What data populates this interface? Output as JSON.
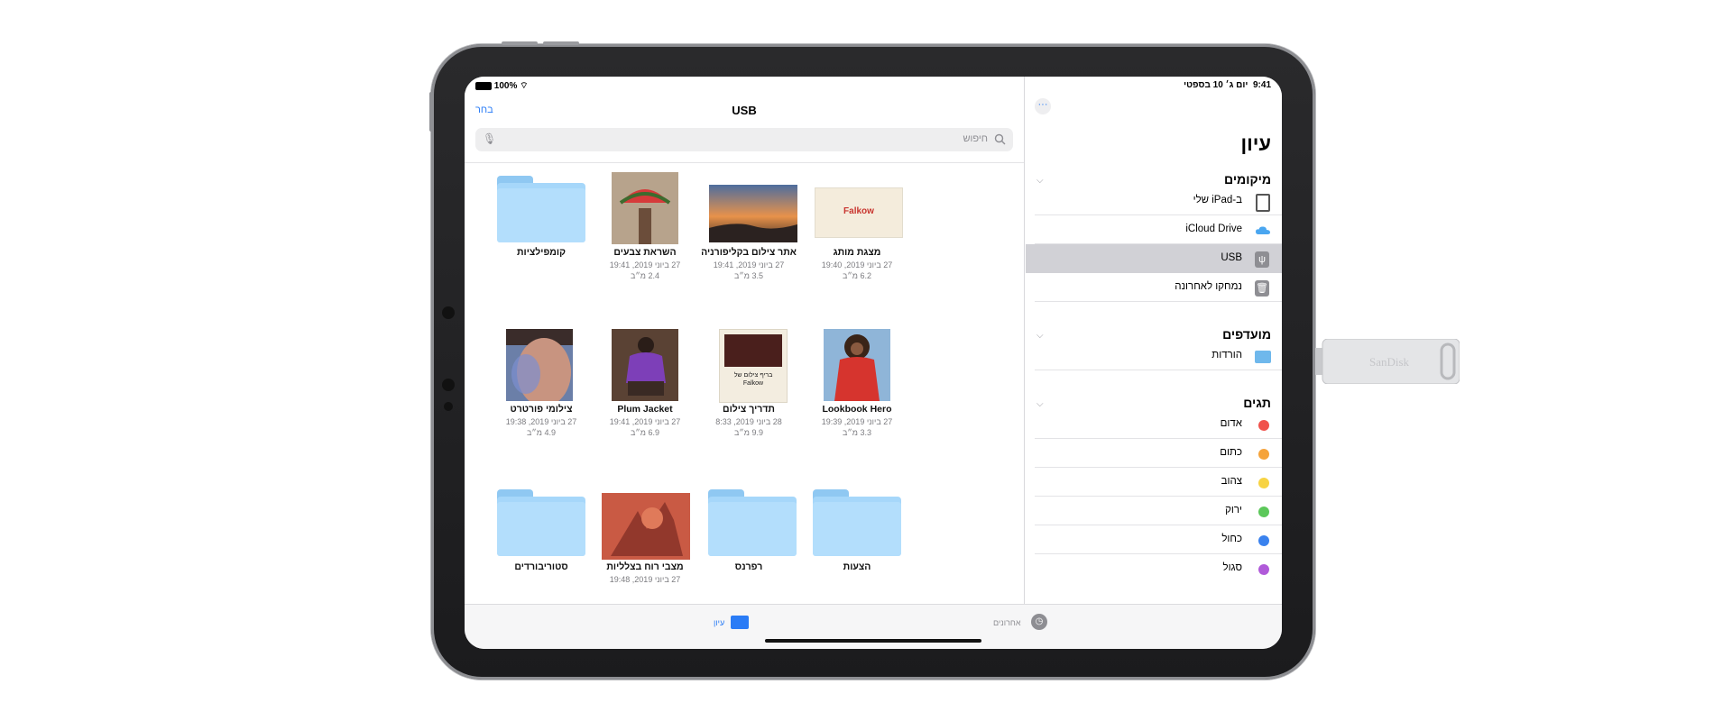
{
  "status": {
    "battery": "100%",
    "time": "9:41",
    "date": "יום ג׳ 10 בספטי"
  },
  "header": {
    "title": "USB",
    "select_label": "בחר",
    "search_placeholder": "חיפוש"
  },
  "grid": [
    {
      "kind": "folder",
      "name": "קומפילציות",
      "date": "",
      "size": ""
    },
    {
      "kind": "photo-watermelon",
      "name": "השראת צבעים",
      "date": "27 ביוני 2019, 19:41",
      "size": "2.4 מ״ב"
    },
    {
      "kind": "photo-sunset",
      "name": "אתר צילום בקליפורניה",
      "date": "27 ביוני 2019, 19:41",
      "size": "3.5 מ״ב"
    },
    {
      "kind": "doc-falkow",
      "name": "מצגת מותג",
      "date": "27 ביוני 2019, 19:40",
      "size": "6.2 מ״ב",
      "thumb_text": "Falkow"
    },
    {
      "kind": "photo-face",
      "name": "צילומי פורטרט",
      "date": "27 ביוני 2019, 19:38",
      "size": "4.9 מ״ב"
    },
    {
      "kind": "photo-purple",
      "name": "Plum Jacket",
      "date": "27 ביוני 2019, 19:41",
      "size": "6.9 מ״ב"
    },
    {
      "kind": "doc-guide",
      "name": "תדריך צילום",
      "date": "28 ביוני 2019, 8:33",
      "size": "9.9 מ״ב",
      "thumb_text": "בריף צילום של Falkow"
    },
    {
      "kind": "photo-red",
      "name": "Lookbook Hero",
      "date": "27 ביוני 2019, 19:39",
      "size": "3.3 מ״ב"
    },
    {
      "kind": "folder",
      "name": "סטוריבורדים",
      "date": "",
      "size": ""
    },
    {
      "kind": "photo-shadow",
      "name": "מצבי רוח בצלליות",
      "date": "27 ביוני 2019, 19:48",
      "size": ""
    },
    {
      "kind": "folder",
      "name": "רפרנס",
      "date": "",
      "size": ""
    },
    {
      "kind": "folder",
      "name": "הצעות",
      "date": "",
      "size": ""
    }
  ],
  "sidebar": {
    "title": "עיון",
    "locations_label": "מיקומים",
    "locations": [
      {
        "label": "ב-iPad שלי",
        "icon": "ipad-icon"
      },
      {
        "label": "iCloud Drive",
        "icon": "cloud-icon"
      },
      {
        "label": "USB",
        "icon": "usb-icon",
        "selected": true
      },
      {
        "label": "נמחקו לאחרונה",
        "icon": "trash-icon"
      }
    ],
    "favorites_label": "מועדפים",
    "favorites": [
      {
        "label": "הורדות",
        "icon": "downloads-folder-icon"
      }
    ],
    "tags_label": "תגים",
    "tags": [
      {
        "label": "אדום",
        "color": "#f0524c"
      },
      {
        "label": "כתום",
        "color": "#f5a33a"
      },
      {
        "label": "צהוב",
        "color": "#f7d343"
      },
      {
        "label": "ירוק",
        "color": "#5cc75a"
      },
      {
        "label": "כחול",
        "color": "#3a82ee"
      },
      {
        "label": "סגול",
        "color": "#b05ad9"
      }
    ]
  },
  "tabbar": {
    "browse_label": "עיון",
    "recents_label": "אחרונים"
  },
  "usb_drive": {
    "brand": "SanDisk"
  }
}
